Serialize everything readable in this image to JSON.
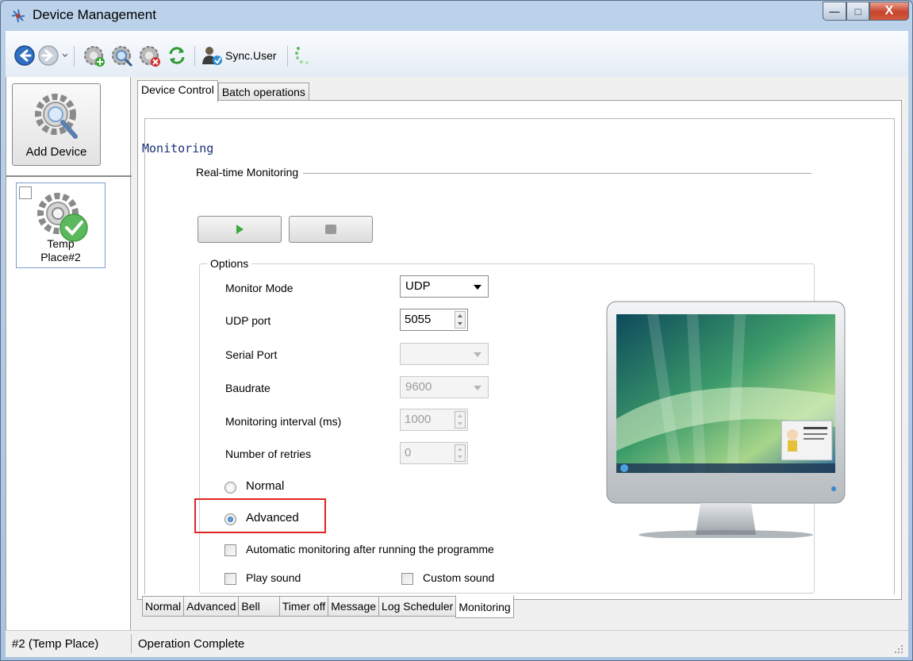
{
  "window": {
    "title": "Device Management",
    "controls": {
      "minimize": "—",
      "maximize": "□",
      "close": "X"
    }
  },
  "toolbar": {
    "items": [
      {
        "icon": "back-arrow-icon"
      },
      {
        "icon": "forward-arrow-icon"
      },
      {
        "icon": "gear-add-icon"
      },
      {
        "icon": "gear-search-icon"
      },
      {
        "icon": "gear-delete-icon"
      },
      {
        "icon": "refresh-icon"
      },
      {
        "icon": "user-sync-icon"
      },
      {
        "icon": "loading-spinner-icon"
      }
    ],
    "sync_user_label": "Sync.User"
  },
  "left_panel": {
    "add_device_label": "Add Device",
    "device": {
      "label_line1": "Temp",
      "label_line2": "Place#2",
      "status": "connected"
    }
  },
  "top_tabs": [
    {
      "label": "Device Control",
      "active": true
    },
    {
      "label": "Batch operations",
      "active": false
    }
  ],
  "monitoring": {
    "heading": "Monitoring",
    "realtime_group": "Real-time Monitoring",
    "options_title": "Options",
    "fields": {
      "monitor_mode": {
        "label": "Monitor Mode",
        "value": "UDP"
      },
      "udp_port": {
        "label": "UDP port",
        "value": "5055"
      },
      "serial_port": {
        "label": "Serial Port",
        "value": ""
      },
      "baudrate": {
        "label": "Baudrate",
        "value": "9600"
      },
      "interval": {
        "label": "Monitoring interval (ms)",
        "value": "1000"
      },
      "retries": {
        "label": "Number of retries",
        "value": "0"
      }
    },
    "radios": {
      "normal": {
        "label": "Normal",
        "checked": false
      },
      "advanced": {
        "label": "Advanced",
        "checked": true
      }
    },
    "checkboxes": {
      "auto_monitor": {
        "label": "Automatic monitoring after running the programme",
        "checked": false
      },
      "play_sound": {
        "label": "Play sound",
        "checked": false
      },
      "custom_sound": {
        "label": "Custom sound",
        "checked": false
      }
    },
    "highlight_color": "#e02424"
  },
  "bottom_tabs": [
    {
      "label": "Normal",
      "active": false
    },
    {
      "label": "Advanced",
      "active": false
    },
    {
      "label": "Bell",
      "active": false
    },
    {
      "label": "Timer off",
      "active": false
    },
    {
      "label": "Message",
      "active": false
    },
    {
      "label": "Log Scheduler",
      "active": false
    },
    {
      "label": "Monitoring",
      "active": true
    }
  ],
  "status_bar": {
    "device": "#2 (Temp Place)",
    "message": "Operation Complete"
  },
  "colors": {
    "accent": "#1d5ca6",
    "heading_text": "#1a2f77",
    "success_green": "#5cb85c"
  }
}
